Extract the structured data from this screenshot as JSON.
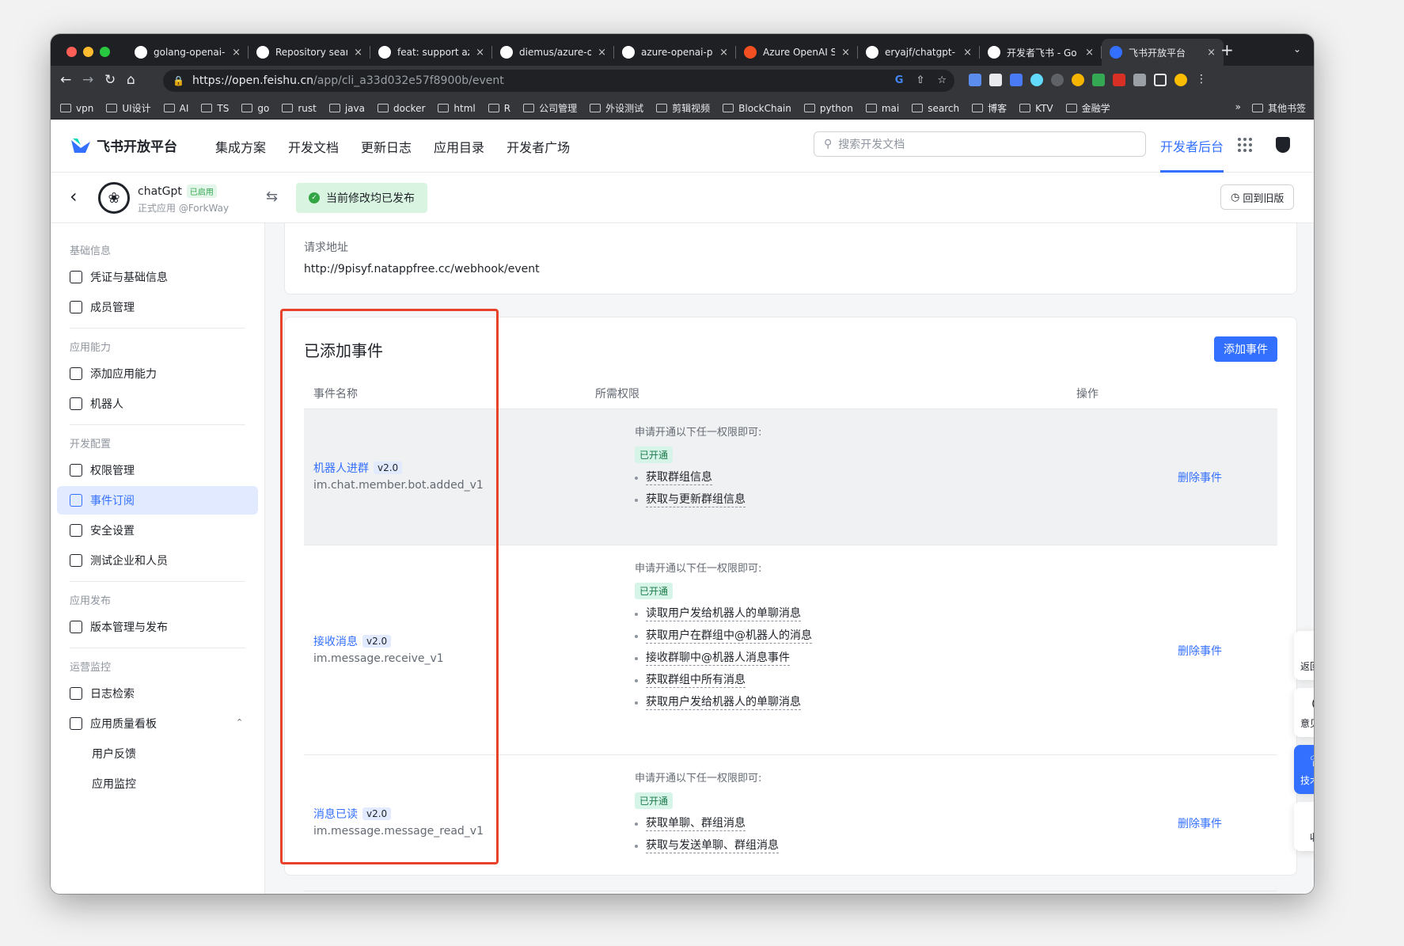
{
  "browser": {
    "tabs": [
      {
        "title": "golang-openai-",
        "icon": "github-icon"
      },
      {
        "title": "Repository sear",
        "icon": "github-icon"
      },
      {
        "title": "feat: support az",
        "icon": "github-icon"
      },
      {
        "title": "diemus/azure-o",
        "icon": "github-icon"
      },
      {
        "title": "azure-openai-p",
        "icon": "github-icon"
      },
      {
        "title": "Azure OpenAI S",
        "icon": "microsoft-icon"
      },
      {
        "title": "eryajf/chatgpt-",
        "icon": "github-icon"
      },
      {
        "title": "开发者飞书 - Go",
        "icon": "google-icon"
      },
      {
        "title": "飞书开放平台",
        "icon": "feishu-icon",
        "active": true
      }
    ],
    "url_host": "https://open.feishu.cn",
    "url_path": "/app/cli_a33d032e57f8900b/event",
    "bookmarks": [
      "vpn",
      "UI设计",
      "AI",
      "TS",
      "go",
      "rust",
      "java",
      "docker",
      "html",
      "R",
      "公司管理",
      "外设测试",
      "剪辑视频",
      "BlockChain",
      "python",
      "mai",
      "search",
      "博客",
      "KTV",
      "金融学"
    ],
    "bookmarks_more": "»",
    "bookmarks_other": "其他书签"
  },
  "header": {
    "logo_text": "飞书开放平台",
    "nav": [
      "集成方案",
      "开发文档",
      "更新日志",
      "应用目录",
      "开发者广场"
    ],
    "search_placeholder": "搜索开发文档",
    "dev_console": "开发者后台"
  },
  "app": {
    "name": "chatGpt",
    "status": "已启用",
    "subtitle": "正式应用 @ForkWay",
    "publish_status": "当前修改均已发布",
    "old_version": "回到旧版"
  },
  "sidebar": {
    "groups": [
      {
        "title": "基础信息",
        "items": [
          {
            "label": "凭证与基础信息",
            "icon": "credential-icon"
          },
          {
            "label": "成员管理",
            "icon": "member-icon"
          }
        ]
      },
      {
        "title": "应用能力",
        "items": [
          {
            "label": "添加应用能力",
            "icon": "add-capability-icon"
          },
          {
            "label": "机器人",
            "icon": "robot-icon"
          }
        ]
      },
      {
        "title": "开发配置",
        "items": [
          {
            "label": "权限管理",
            "icon": "permission-icon"
          },
          {
            "label": "事件订阅",
            "icon": "event-icon",
            "active": true
          },
          {
            "label": "安全设置",
            "icon": "security-icon"
          },
          {
            "label": "测试企业和人员",
            "icon": "test-icon"
          }
        ]
      },
      {
        "title": "应用发布",
        "items": [
          {
            "label": "版本管理与发布",
            "icon": "version-icon"
          }
        ]
      },
      {
        "title": "运营监控",
        "items": [
          {
            "label": "日志检索",
            "icon": "log-icon"
          },
          {
            "label": "应用质量看板",
            "icon": "chart-icon"
          }
        ]
      }
    ],
    "subitems": [
      "用户反馈",
      "应用监控"
    ]
  },
  "request": {
    "label": "请求地址",
    "url": "http://9pisyf.natappfree.cc/webhook/event"
  },
  "events": {
    "title": "已添加事件",
    "add_button": "添加事件",
    "columns": [
      "事件名称",
      "所需权限",
      "操作"
    ],
    "perm_hint": "申请开通以下任一权限即可:",
    "opened": "已开通",
    "delete": "删除事件",
    "rows": [
      {
        "name": "机器人进群",
        "version": "v2.0",
        "key": "im.chat.member.bot.added_v1",
        "perms": [
          "获取群组信息",
          "获取与更新群组信息"
        ]
      },
      {
        "name": "接收消息",
        "version": "v2.0",
        "key": "im.message.receive_v1",
        "perms": [
          "读取用户发给机器人的单聊消息",
          "获取用户在群组中@机器人的消息",
          "接收群聊中@机器人消息事件",
          "获取群组中所有消息",
          "获取用户发给机器人的单聊消息"
        ]
      },
      {
        "name": "消息已读",
        "version": "v2.0",
        "key": "im.message.message_read_v1",
        "perms": [
          "获取单聊、群组消息",
          "获取与发送单聊、群组消息"
        ]
      }
    ]
  },
  "float": {
    "top": "返回顶部",
    "feedback": "意见反馈",
    "support": "技术支持",
    "collapse": "收起"
  },
  "colors": {
    "accent": "#3370ff",
    "highlight": "#e8432a",
    "success": "#32a645"
  }
}
